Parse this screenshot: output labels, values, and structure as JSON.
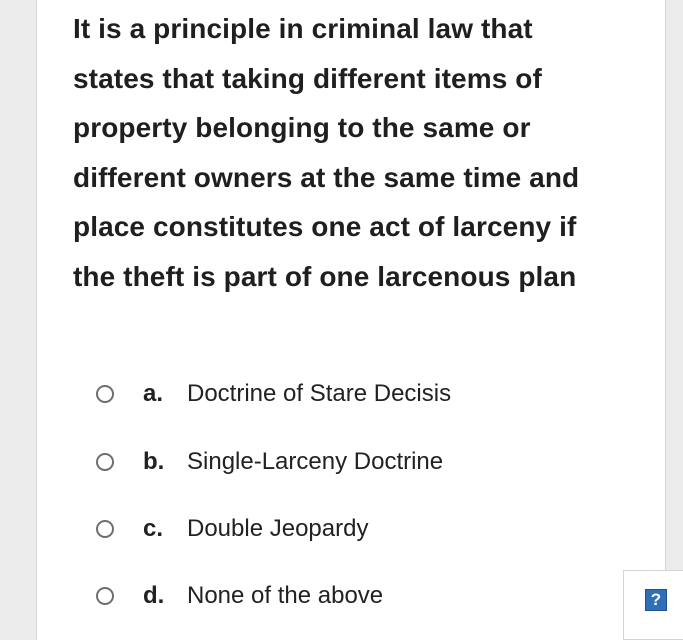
{
  "question": {
    "text": "It is a principle in criminal law that states that taking different items of property belonging to the same or different owners at the same time and place constitutes one act of larceny if the theft is part of one larcenous plan"
  },
  "options": [
    {
      "letter": "a.",
      "text": "Doctrine of Stare Decisis",
      "selected": false
    },
    {
      "letter": "b.",
      "text": "Single-Larceny Doctrine",
      "selected": false
    },
    {
      "letter": "c.",
      "text": "Double Jeopardy",
      "selected": false
    },
    {
      "letter": "d.",
      "text": "None of the above",
      "selected": false
    }
  ],
  "help": {
    "label": "?",
    "icon": "question-mark-icon",
    "color": "#2e6fb8"
  },
  "colors": {
    "page_background": "#ececec",
    "card_background": "#ffffff",
    "text": "#1f1f1f",
    "radio_border": "#6e6e6e"
  }
}
